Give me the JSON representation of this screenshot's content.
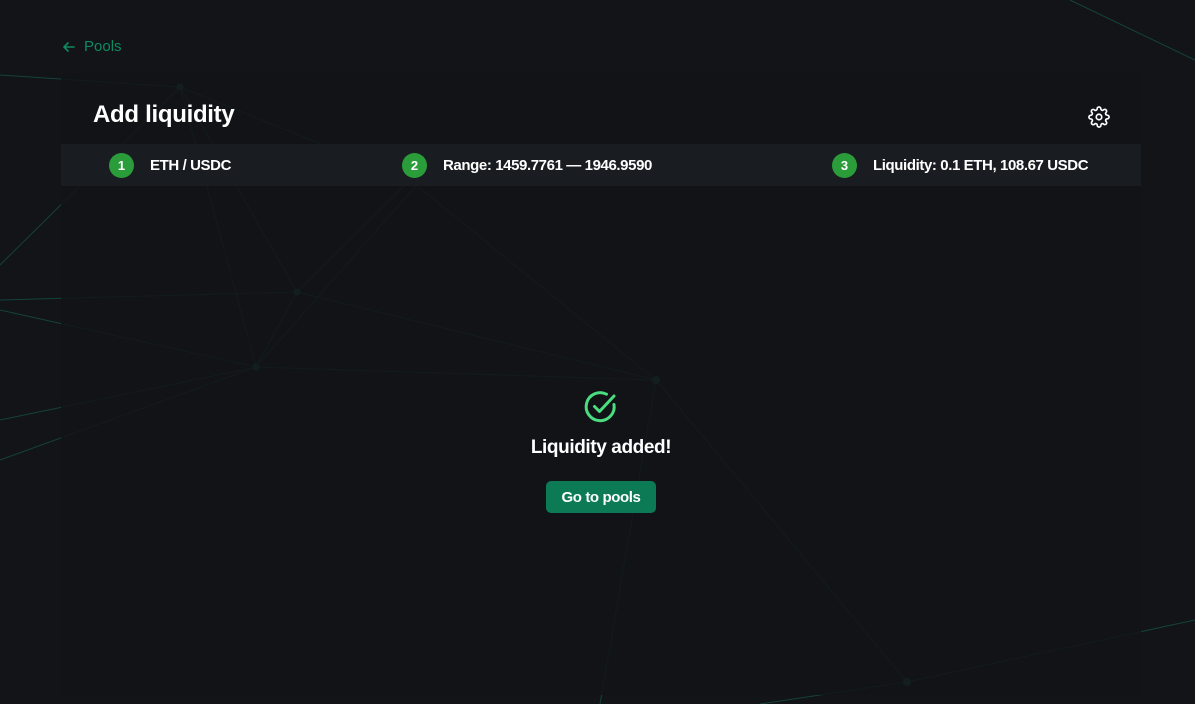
{
  "nav": {
    "back_label": "Pools"
  },
  "card": {
    "title": "Add liquidity"
  },
  "steps": [
    {
      "number": "1",
      "label": "ETH / USDC"
    },
    {
      "number": "2",
      "label": "Range: 1459.7761 — 1946.9590"
    },
    {
      "number": "3",
      "label": "Liquidity: 0.1 ETH, 108.67 USDC"
    }
  ],
  "success": {
    "message": "Liquidity added!",
    "button_label": "Go to pools"
  },
  "icons": {
    "back": "arrow-left-icon",
    "settings": "gear-icon",
    "success": "check-circle-icon"
  },
  "colors": {
    "background": "#121417",
    "accent": "#0b7a55",
    "link": "#0d8a5f",
    "step_badge": "#2a9d3a",
    "success_icon": "#4ade80"
  }
}
